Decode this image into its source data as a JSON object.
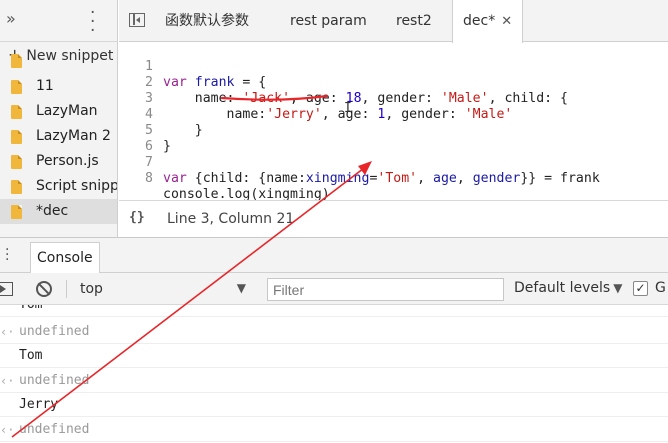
{
  "sidebar": {
    "new_snippet_label": "New snippet",
    "files": [
      {
        "name": "11",
        "selected": false
      },
      {
        "name": "LazyMan",
        "selected": false
      },
      {
        "name": "LazyMan 2",
        "selected": false
      },
      {
        "name": "Person.js",
        "selected": false
      },
      {
        "name": "Script snippet",
        "selected": false
      },
      {
        "name": "*dec",
        "selected": true
      }
    ]
  },
  "tabs": [
    {
      "label": "函数默认参数"
    },
    {
      "label": "rest param"
    },
    {
      "label": "rest2"
    },
    {
      "label": "dec*",
      "active": true
    }
  ],
  "editor": {
    "lines": [
      {
        "num": "1",
        "text": "var frank = {"
      },
      {
        "num": "2",
        "text": "    name: 'Jack', age: 18, gender: 'Male', child: {"
      },
      {
        "num": "3",
        "text": "        name:'Jerry', age: 1, gender: 'Male'"
      },
      {
        "num": "4",
        "text": "    }"
      },
      {
        "num": "5",
        "text": "}"
      },
      {
        "num": "6",
        "text": ""
      },
      {
        "num": "7",
        "text": "var {child: {name:xingming='Tom', age, gender}} = frank"
      },
      {
        "num": "8",
        "text": "console.log(xingming)"
      }
    ],
    "status": "Line 3, Column 21",
    "pretty_print_label": "{}"
  },
  "drawer": {
    "console_tab": "Console"
  },
  "console_toolbar": {
    "context": "top",
    "filter_placeholder": "Filter",
    "levels": "Default levels",
    "group_label": "G"
  },
  "console": {
    "messages": [
      {
        "text": "Tom",
        "kind": "log"
      },
      {
        "text": "undefined",
        "kind": "result"
      },
      {
        "text": "Tom",
        "kind": "log"
      },
      {
        "text": "undefined",
        "kind": "result"
      },
      {
        "text": "Jerry",
        "kind": "log"
      },
      {
        "text": "undefined",
        "kind": "result"
      }
    ]
  },
  "annotations": {
    "color": "#e8262a"
  },
  "icons": {
    "more": "more-vertical-icon",
    "expand": "chevron-double-right-icon",
    "toggle_navigator": "toggle-navigator-icon",
    "execute": "execute-context-icon",
    "clear": "clear-console-icon"
  }
}
